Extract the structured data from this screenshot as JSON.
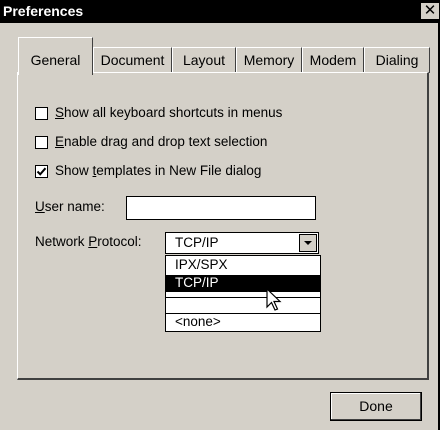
{
  "window": {
    "title": "Preferences",
    "close_glyph": "✕"
  },
  "tabs": [
    {
      "label": "General",
      "active": true
    },
    {
      "label": "Document",
      "active": false
    },
    {
      "label": "Layout",
      "active": false
    },
    {
      "label": "Memory",
      "active": false
    },
    {
      "label": "Modem",
      "active": false
    },
    {
      "label": "Dialing",
      "active": false
    }
  ],
  "options": [
    {
      "pre": "",
      "key": "S",
      "post": "how all keyboard shortcuts in menus",
      "checked": false
    },
    {
      "pre": "",
      "key": "E",
      "post": "nable drag and drop text selection",
      "checked": false
    },
    {
      "pre": "Show ",
      "key": "t",
      "post": "emplates in New File dialog",
      "checked": true
    }
  ],
  "user_name": {
    "key": "U",
    "label_rest": "ser name:",
    "value": ""
  },
  "network": {
    "label_pre": "Network ",
    "key": "P",
    "label_post": "rotocol:",
    "selected": "TCP/IP",
    "list": [
      "IPX/SPX",
      "TCP/IP",
      "",
      "<none>"
    ],
    "highlighted_index": 1
  },
  "buttons": {
    "done": "Done"
  },
  "icons": {
    "dropdown_arrow": "triangle-down-icon",
    "cursor": "arrow-cursor-icon",
    "close": "close-icon",
    "check": "checkmark-icon"
  }
}
